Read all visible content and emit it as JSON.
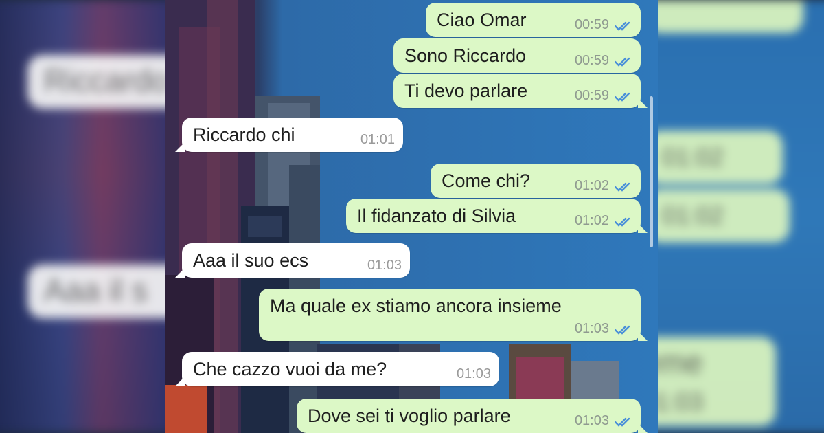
{
  "background_blurred": {
    "left": [
      "Riccardo",
      "Aaa il s"
    ],
    "right": [
      "01:02",
      "01:02",
      "eme",
      "01:03"
    ]
  },
  "messages": [
    {
      "direction": "out",
      "text": "Ciao Omar",
      "time": "00:59",
      "read": true
    },
    {
      "direction": "out",
      "text": "Sono Riccardo",
      "time": "00:59",
      "read": true
    },
    {
      "direction": "out",
      "text": "Ti devo parlare",
      "time": "00:59",
      "read": true
    },
    {
      "direction": "in",
      "text": "Riccardo chi",
      "time": "01:01"
    },
    {
      "direction": "out",
      "text": "Come chi?",
      "time": "01:02",
      "read": true
    },
    {
      "direction": "out",
      "text": "Il fidanzato di Silvia",
      "time": "01:02",
      "read": true
    },
    {
      "direction": "in",
      "text": "Aaa il suo ecs",
      "time": "01:03"
    },
    {
      "direction": "out",
      "text": "Ma quale ex stiamo ancora insieme",
      "time": "01:03",
      "read": true
    },
    {
      "direction": "in",
      "text": "Che cazzo vuoi da me?",
      "time": "01:03"
    },
    {
      "direction": "out",
      "text": "Dove sei ti voglio parlare",
      "time": "01:03",
      "read": true
    }
  ],
  "colors": {
    "outgoing_bubble": "#dcf8c6",
    "incoming_bubble": "#ffffff",
    "read_ticks": "#4a90d9",
    "timestamp": "#8f9a90"
  },
  "icons": {
    "read_receipt": "double-check-icon"
  }
}
